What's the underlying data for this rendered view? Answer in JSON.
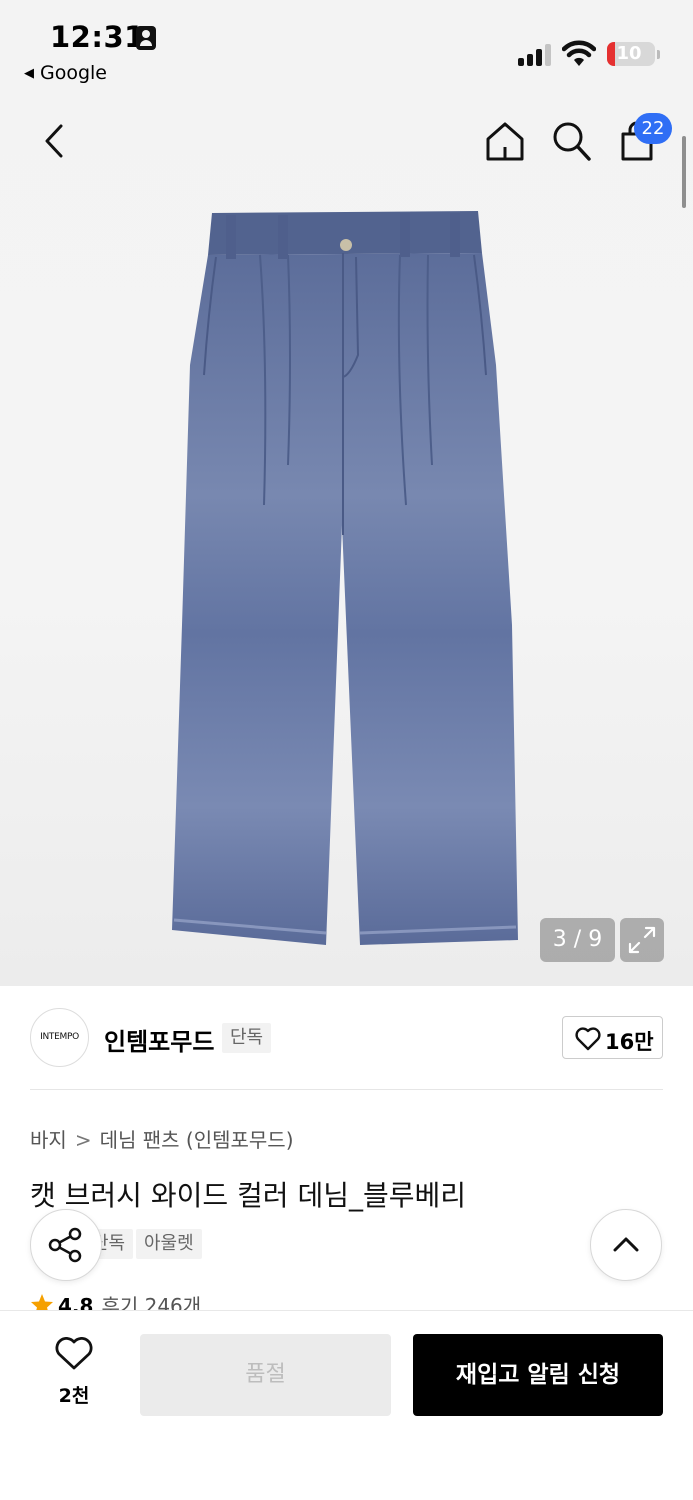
{
  "status_bar": {
    "time": "12:31",
    "back_app": "Google",
    "battery": "10"
  },
  "header": {
    "cart_count": "22"
  },
  "gallery": {
    "counter": "3 / 9"
  },
  "brand": {
    "logo_text": "INTEMPO",
    "name": "인템포무드",
    "tag": "단독",
    "likes": "16만"
  },
  "breadcrumb": {
    "category": "바지",
    "subcategory": "데님 팬츠 (인템포무드)"
  },
  "product": {
    "title": "캣 브러시 와이드 컬러 데님_블루베리",
    "tags": [
      "단독",
      "아울렛"
    ],
    "rating": "4.8",
    "reviews": "후기 246개"
  },
  "bottom_bar": {
    "wish_count": "2천",
    "soldout_label": "품절",
    "restock_label": "재입고 알림 신청"
  }
}
